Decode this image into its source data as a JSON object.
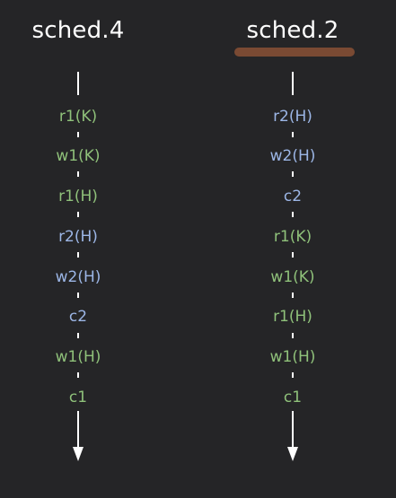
{
  "schedules": [
    {
      "title": "sched.4",
      "highlighted": false,
      "operations": [
        {
          "text": "r1(K)",
          "color": "green"
        },
        {
          "text": "w1(K)",
          "color": "green"
        },
        {
          "text": "r1(H)",
          "color": "green"
        },
        {
          "text": "r2(H)",
          "color": "blue"
        },
        {
          "text": "w2(H)",
          "color": "blue"
        },
        {
          "text": "c2",
          "color": "blue"
        },
        {
          "text": "w1(H)",
          "color": "green"
        },
        {
          "text": "c1",
          "color": "green"
        }
      ]
    },
    {
      "title": "sched.2",
      "highlighted": true,
      "operations": [
        {
          "text": "r2(H)",
          "color": "blue"
        },
        {
          "text": "w2(H)",
          "color": "blue"
        },
        {
          "text": "c2",
          "color": "blue"
        },
        {
          "text": "r1(K)",
          "color": "green"
        },
        {
          "text": "w1(K)",
          "color": "green"
        },
        {
          "text": "r1(H)",
          "color": "green"
        },
        {
          "text": "w1(H)",
          "color": "green"
        },
        {
          "text": "c1",
          "color": "green"
        }
      ]
    }
  ],
  "colors": {
    "background": "#252527",
    "transaction1": "#8fc17a",
    "transaction2": "#9cb6e6",
    "highlight": "#7a4a33",
    "axis": "#ffffff"
  }
}
